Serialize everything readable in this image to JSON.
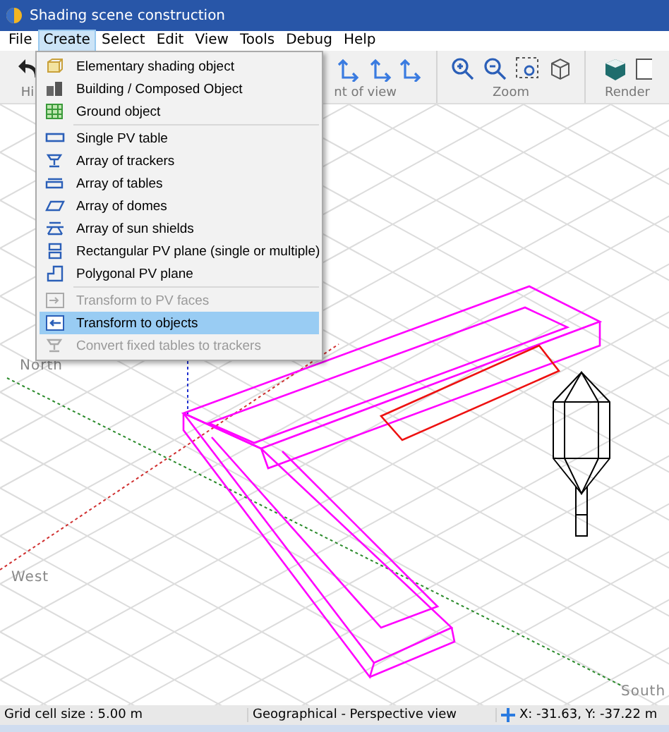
{
  "window": {
    "title": "Shading scene construction"
  },
  "menubar": [
    {
      "label": "File",
      "selected": false
    },
    {
      "label": "Create",
      "selected": true
    },
    {
      "label": "Select",
      "selected": false
    },
    {
      "label": "Edit",
      "selected": false
    },
    {
      "label": "View",
      "selected": false
    },
    {
      "label": "Tools",
      "selected": false
    },
    {
      "label": "Debug",
      "selected": false
    },
    {
      "label": "Help",
      "selected": false
    }
  ],
  "toolbar_groups": [
    {
      "label": "Hi"
    },
    {
      "label": "nt of view"
    },
    {
      "label": "Zoom"
    },
    {
      "label": "Render"
    }
  ],
  "menu": [
    {
      "kind": "item",
      "label": "Elementary shading object",
      "disabled": false,
      "selected": false
    },
    {
      "kind": "item",
      "label": "Building / Composed Object",
      "disabled": false,
      "selected": false
    },
    {
      "kind": "item",
      "label": "Ground object",
      "disabled": false,
      "selected": false
    },
    {
      "kind": "separator"
    },
    {
      "kind": "item",
      "label": "Single PV table",
      "disabled": false,
      "selected": false
    },
    {
      "kind": "item",
      "label": "Array of trackers",
      "disabled": false,
      "selected": false
    },
    {
      "kind": "item",
      "label": "Array of tables",
      "disabled": false,
      "selected": false
    },
    {
      "kind": "item",
      "label": "Array of domes",
      "disabled": false,
      "selected": false
    },
    {
      "kind": "item",
      "label": "Array of sun shields",
      "disabled": false,
      "selected": false
    },
    {
      "kind": "item",
      "label": "Rectangular PV plane (single or multiple)",
      "disabled": false,
      "selected": false
    },
    {
      "kind": "item",
      "label": "Polygonal PV plane",
      "disabled": false,
      "selected": false
    },
    {
      "kind": "separator"
    },
    {
      "kind": "item",
      "label": "Transform to PV faces",
      "disabled": true,
      "selected": false
    },
    {
      "kind": "item",
      "label": "Transform to objects",
      "disabled": false,
      "selected": true
    },
    {
      "kind": "item",
      "label": "Convert fixed tables to trackers",
      "disabled": true,
      "selected": false
    }
  ],
  "scene": {
    "compass": [
      {
        "label": "North",
        "kind": "north"
      },
      {
        "label": "West",
        "kind": "west"
      },
      {
        "label": "South",
        "kind": "south"
      }
    ]
  },
  "status_bar": {
    "grid": "Grid cell size :  5.00 m",
    "view": "Geographical - Perspective view",
    "coords": "X: -31.63, Y: -37.22 m"
  }
}
